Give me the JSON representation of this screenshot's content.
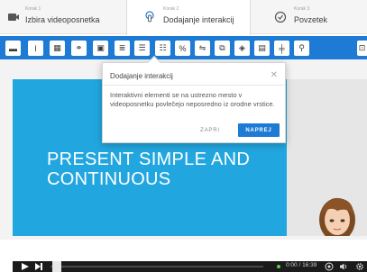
{
  "steps": [
    {
      "step": "Korak 1",
      "name": "Izbira videoposnetka",
      "icon": "video-camera-icon"
    },
    {
      "step": "Korak 2",
      "name": "Dodajanje interakcij",
      "icon": "hand-pointer-icon"
    },
    {
      "step": "Korak 3",
      "name": "Povzetek",
      "icon": "checkmark-circle-icon"
    }
  ],
  "toolbar": {
    "background_color": "#1d7bd6",
    "buttons": [
      {
        "icon": "label-icon",
        "glyph": "▬"
      },
      {
        "icon": "text-icon",
        "glyph": "I"
      },
      {
        "icon": "table-icon",
        "glyph": "▦"
      },
      {
        "icon": "link-icon",
        "glyph": "🔗"
      },
      {
        "icon": "image-icon",
        "glyph": "▣"
      },
      {
        "icon": "statements-icon",
        "glyph": "≣"
      },
      {
        "icon": "single-choice-icon",
        "glyph": "☰"
      },
      {
        "icon": "multiple-choice-icon",
        "glyph": "☷"
      },
      {
        "icon": "fill-blanks-icon",
        "glyph": "%"
      },
      {
        "icon": "drag-text-icon",
        "glyph": "⇋"
      },
      {
        "icon": "crossroads-icon",
        "glyph": "⧉"
      },
      {
        "icon": "navigation-hotspot-icon",
        "glyph": "◈"
      },
      {
        "icon": "mark-words-icon",
        "glyph": "▤"
      },
      {
        "icon": "drag-drop-icon",
        "glyph": "╪"
      },
      {
        "icon": "find-hotspot-icon",
        "glyph": "⚲"
      },
      {
        "icon": "more-icon",
        "glyph": "⊡"
      }
    ]
  },
  "slide": {
    "title": "PRESENT SIMPLE AND CONTINUOUS",
    "background_color": "#22a6df"
  },
  "dialog": {
    "title": "Dodajanje interakcij",
    "body": "Interaktivni elementi se na ustrezno mesto v videoposnetku povlečejo neposredno iz orodne vrstice.",
    "close_label": "ZAPRI",
    "next_label": "NAPREJ",
    "accent_color": "#1d7bd6"
  },
  "player": {
    "time": "0:00 / 16:39",
    "progress_fraction": 0.0
  }
}
